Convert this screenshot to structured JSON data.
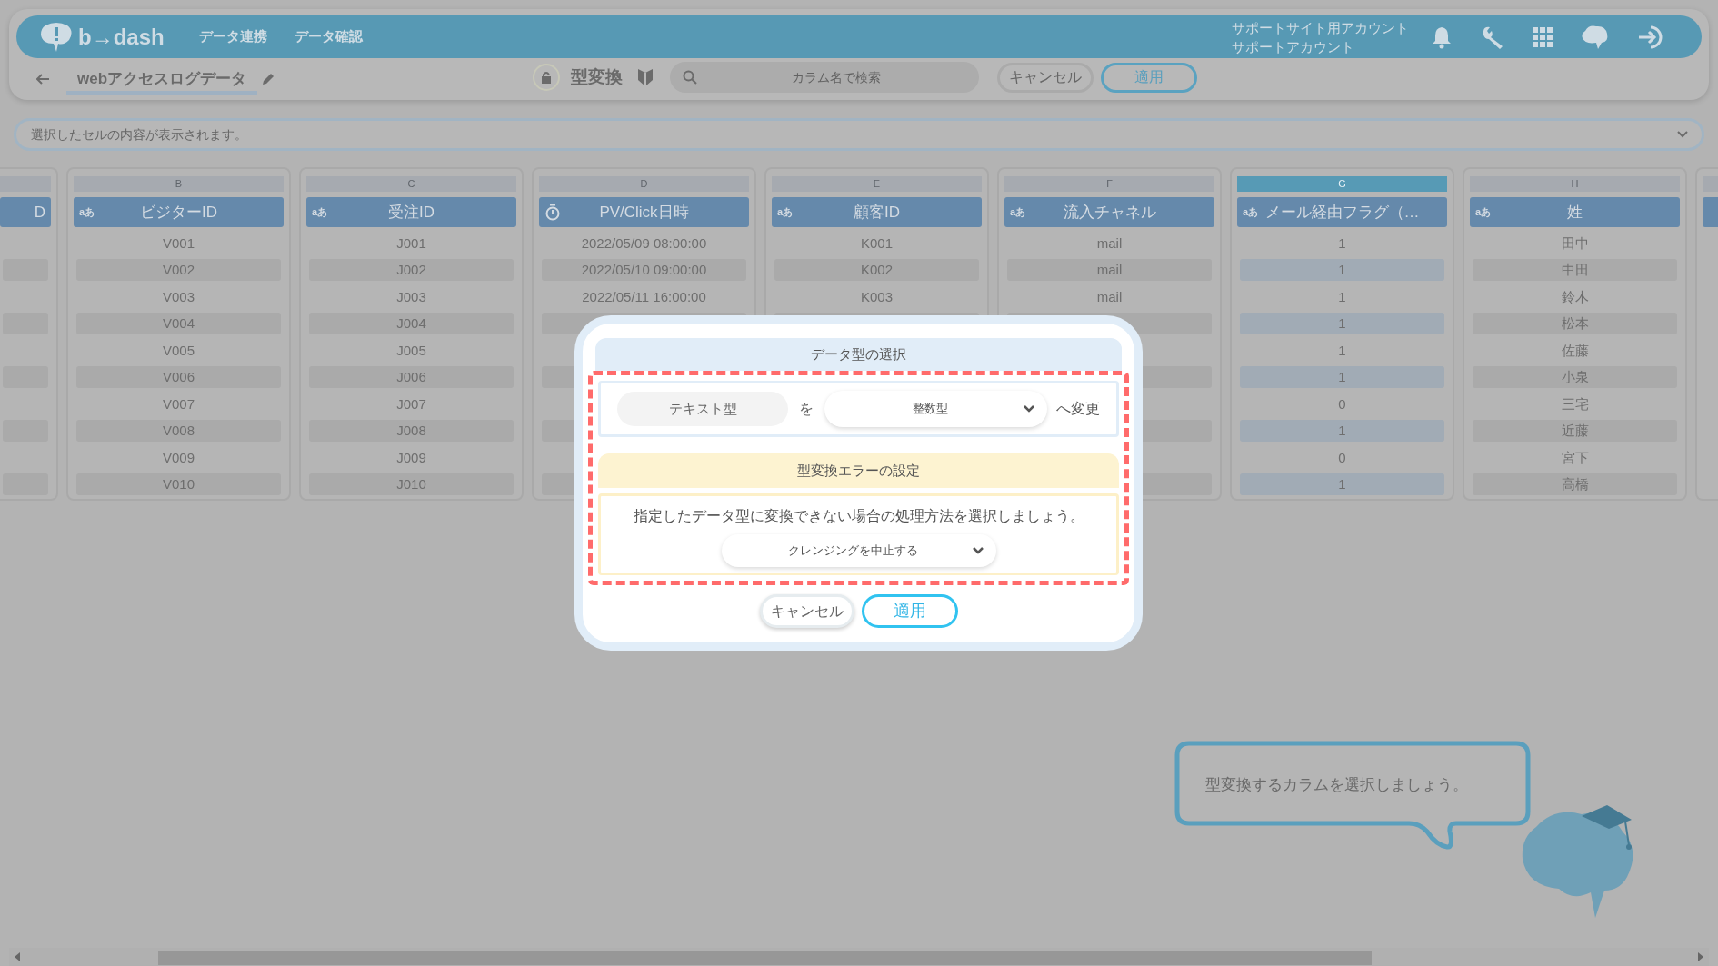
{
  "header": {
    "logo": "b→dash",
    "nav": [
      "データ連携",
      "データ確認"
    ],
    "account": [
      "サポートサイト用アカウント",
      "サポートアカウント"
    ]
  },
  "toolbar": {
    "dataset_title": "webアクセスログデータ",
    "mode_title": "型変換",
    "search": {
      "placeholder": "カラム名で検索"
    },
    "buttons": [
      {
        "label": "キャンセル",
        "kind": "secondary"
      },
      {
        "label": "適用",
        "kind": "primary"
      }
    ]
  },
  "cell_preview": {
    "placeholder": "選択したセルの内容が表示されます。"
  },
  "columns": [
    {
      "kind": "cut_off",
      "name": "D",
      "selected": false
    },
    {
      "kind": "text",
      "letter": "B",
      "type_badge": "aあ",
      "name": "ビジターID",
      "selected": false,
      "cells": [
        "V001",
        "V002",
        "V003",
        "V004",
        "V005",
        "V006",
        "V007",
        "V008",
        "V009",
        "V010"
      ]
    },
    {
      "kind": "text",
      "letter": "C",
      "type_badge": "aあ",
      "name": "受注ID",
      "selected": false,
      "cells": [
        "J001",
        "J002",
        "J003",
        "J004",
        "J005",
        "J006",
        "J007",
        "J008",
        "J009",
        "J010"
      ]
    },
    {
      "kind": "datetime",
      "letter": "D",
      "name": "PV/Click日時",
      "selected": false,
      "cells": [
        "2022/05/09 08:00:00",
        "2022/05/10 09:00:00",
        "2022/05/11 16:00:00"
      ]
    },
    {
      "kind": "text",
      "letter": "E",
      "type_badge": "aあ",
      "name": "顧客ID",
      "selected": false,
      "cells": [
        "K001",
        "K002",
        "K003"
      ]
    },
    {
      "kind": "text",
      "letter": "F",
      "type_badge": "aあ",
      "name": "流入チャネル",
      "selected": false,
      "cells": [
        "mail",
        "mail",
        "mail"
      ]
    },
    {
      "kind": "text",
      "letter": "G",
      "type_badge": "aあ",
      "name": "メール経由フラグ（…",
      "selected": true,
      "cells": [
        "1",
        "1",
        "1",
        "1",
        "1",
        "1",
        "0",
        "1",
        "0",
        "1"
      ]
    },
    {
      "kind": "text",
      "letter": "H",
      "type_badge": "aあ",
      "name": "姓",
      "selected": false,
      "cells": [
        "田中",
        "中田",
        "鈴木",
        "松本",
        "佐藤",
        "小泉",
        "三宅",
        "近藤",
        "宮下",
        "高橋"
      ]
    },
    {
      "kind": "cut_off",
      "selected": false
    }
  ],
  "dialog": {
    "title": "データ型の選択",
    "highlighted": true,
    "from_type": "テキスト型",
    "particle": "を",
    "to_type": {
      "value": "整数型"
    },
    "suffix": "へ変更",
    "error_title": "型変換エラーの設定",
    "error_text": "指定したデータ型に変換できない場合の処理方法を選択しましょう。",
    "error_action": {
      "value": "クレンジングを中止する"
    },
    "buttons": [
      {
        "label": "キャンセル",
        "kind": "secondary"
      },
      {
        "label": "適用",
        "kind": "primary"
      }
    ]
  },
  "hint": {
    "text": "型変換するカラムを選択しましょう。"
  }
}
